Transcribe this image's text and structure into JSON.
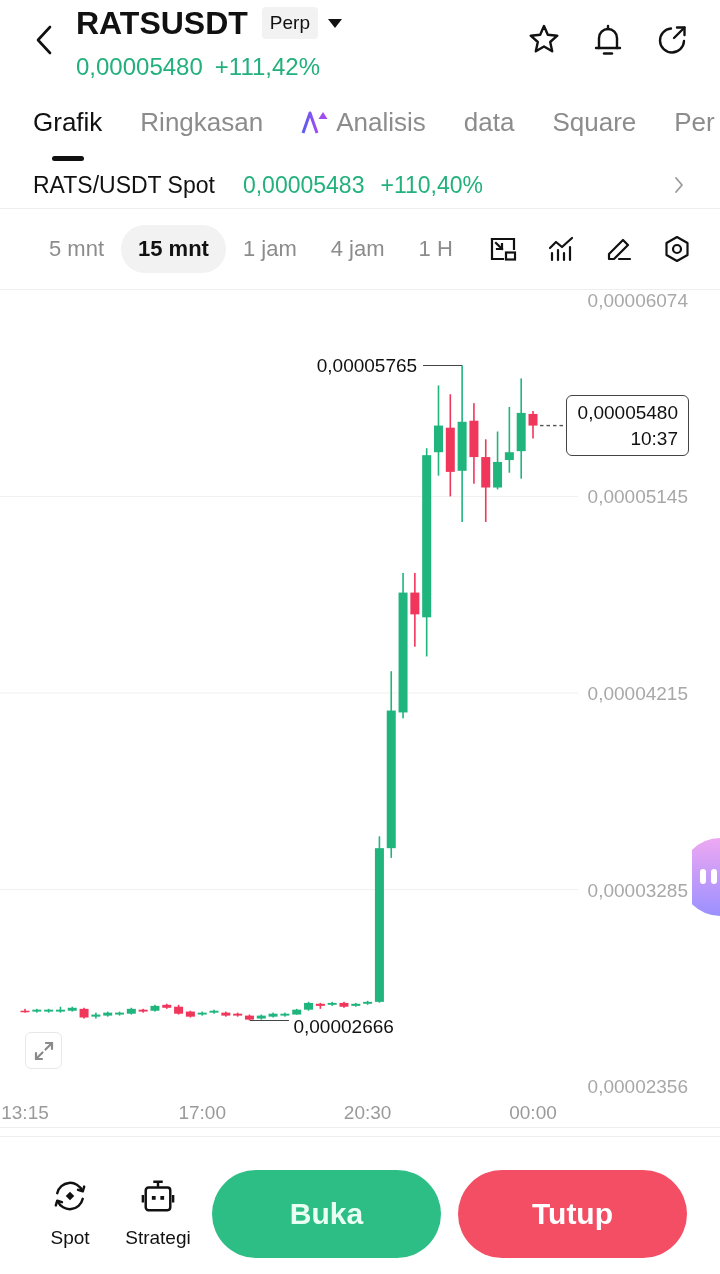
{
  "header": {
    "title": "RATSUSDT",
    "badge": "Perp",
    "price": "0,00005480",
    "change": "+111,42%"
  },
  "tabs": [
    {
      "label": "Grafik",
      "kind": "plain",
      "selected": true
    },
    {
      "label": "Ringkasan",
      "kind": "plain",
      "selected": false
    },
    {
      "label": "Analisis",
      "kind": "ai",
      "selected": false
    },
    {
      "label": "data",
      "kind": "plain",
      "selected": false
    },
    {
      "label": "Square",
      "kind": "plain",
      "selected": false
    },
    {
      "label": "Per",
      "kind": "plain",
      "selected": false
    }
  ],
  "spot_ticker": {
    "pair": "RATS/USDT Spot",
    "price": "0,00005483",
    "change": "+110,40%"
  },
  "timeframes": [
    {
      "label": "5 mnt",
      "selected": false
    },
    {
      "label": "15 mnt",
      "selected": true
    },
    {
      "label": "1 jam",
      "selected": false
    },
    {
      "label": "4 jam",
      "selected": false
    },
    {
      "label": "1 H",
      "selected": false
    }
  ],
  "chart": {
    "chart_data": {
      "type": "candlestick",
      "x": [
        13.25,
        13.5,
        13.75,
        14,
        14.25,
        14.5,
        14.75,
        15,
        15.25,
        15.5,
        15.75,
        16,
        16.25,
        16.5,
        16.75,
        17,
        17.25,
        17.5,
        17.75,
        18,
        18.25,
        18.5,
        18.75,
        19,
        19.25,
        19.5,
        19.75,
        20,
        20.25,
        20.5,
        20.75,
        21,
        21.25,
        21.5,
        21.75,
        22,
        22.25,
        22.5,
        22.75,
        23,
        23.25,
        23.5,
        23.75,
        24
      ],
      "ohlc": [
        [
          2.712e-05,
          2.721e-05,
          2.703e-05,
          2.708e-05
        ],
        [
          2.708e-05,
          2.721e-05,
          2.703e-05,
          2.717e-05
        ],
        [
          2.708e-05,
          2.721e-05,
          2.703e-05,
          2.717e-05
        ],
        [
          2.708e-05,
          2.731e-05,
          2.703e-05,
          2.717e-05
        ],
        [
          2.712e-05,
          2.731e-05,
          2.708e-05,
          2.726e-05
        ],
        [
          2.721e-05,
          2.726e-05,
          2.675e-05,
          2.68e-05
        ],
        [
          2.684e-05,
          2.703e-05,
          2.675e-05,
          2.694e-05
        ],
        [
          2.689e-05,
          2.708e-05,
          2.684e-05,
          2.703e-05
        ],
        [
          2.694e-05,
          2.708e-05,
          2.689e-05,
          2.703e-05
        ],
        [
          2.698e-05,
          2.726e-05,
          2.694e-05,
          2.721e-05
        ],
        [
          2.717e-05,
          2.721e-05,
          2.703e-05,
          2.708e-05
        ],
        [
          2.712e-05,
          2.74e-05,
          2.708e-05,
          2.735e-05
        ],
        [
          2.74e-05,
          2.745e-05,
          2.721e-05,
          2.726e-05
        ],
        [
          2.731e-05,
          2.74e-05,
          2.694e-05,
          2.698e-05
        ],
        [
          2.708e-05,
          2.712e-05,
          2.68e-05,
          2.684e-05
        ],
        [
          2.694e-05,
          2.708e-05,
          2.689e-05,
          2.703e-05
        ],
        [
          2.703e-05,
          2.717e-05,
          2.698e-05,
          2.712e-05
        ],
        [
          2.703e-05,
          2.708e-05,
          2.684e-05,
          2.689e-05
        ],
        [
          2.698e-05,
          2.703e-05,
          2.684e-05,
          2.689e-05
        ],
        [
          2.689e-05,
          2.694e-05,
          2.666e-05,
          2.67e-05
        ],
        [
          2.675e-05,
          2.694e-05,
          2.67e-05,
          2.689e-05
        ],
        [
          2.684e-05,
          2.703e-05,
          2.68e-05,
          2.698e-05
        ],
        [
          2.689e-05,
          2.703e-05,
          2.684e-05,
          2.698e-05
        ],
        [
          2.694e-05,
          2.721e-05,
          2.694e-05,
          2.717e-05
        ],
        [
          2.717e-05,
          2.754e-05,
          2.712e-05,
          2.749e-05
        ],
        [
          2.745e-05,
          2.749e-05,
          2.721e-05,
          2.735e-05
        ],
        [
          2.74e-05,
          2.754e-05,
          2.735e-05,
          2.749e-05
        ],
        [
          2.749e-05,
          2.754e-05,
          2.726e-05,
          2.731e-05
        ],
        [
          2.735e-05,
          2.749e-05,
          2.731e-05,
          2.745e-05
        ],
        [
          2.745e-05,
          2.759e-05,
          2.74e-05,
          2.754e-05
        ],
        [
          2.754e-05,
          3.537e-05,
          2.75e-05,
          3.481e-05
        ],
        [
          3.481e-05,
          4.318e-05,
          3.435e-05,
          4.132e-05
        ],
        [
          4.123e-05,
          4.783e-05,
          4.095e-05,
          4.69e-05
        ],
        [
          4.69e-05,
          4.783e-05,
          4.434e-05,
          4.587e-05
        ],
        [
          4.573e-05,
          5.373e-05,
          4.388e-05,
          5.34e-05
        ],
        [
          5.354e-05,
          5.67e-05,
          5.243e-05,
          5.48e-05
        ],
        [
          5.47e-05,
          5.628e-05,
          5.145e-05,
          5.261e-05
        ],
        [
          5.266e-05,
          5.765e-05,
          5.024e-05,
          5.498e-05
        ],
        [
          5.503e-05,
          5.586e-05,
          5.205e-05,
          5.331e-05
        ],
        [
          5.331e-05,
          5.415e-05,
          5.024e-05,
          5.187e-05
        ],
        [
          5.187e-05,
          5.452e-05,
          5.178e-05,
          5.308e-05
        ],
        [
          5.317e-05,
          5.568e-05,
          5.257e-05,
          5.354e-05
        ],
        [
          5.359e-05,
          5.703e-05,
          5.229e-05,
          5.54e-05
        ],
        [
          5.535e-05,
          5.549e-05,
          5.419e-05,
          5.48e-05
        ]
      ],
      "xlim": [
        13.25,
        24
      ],
      "ylim": [
        2.356e-05,
        6.074e-05
      ],
      "xticks": [
        {
          "value": 13.25,
          "label": "13:15"
        },
        {
          "value": 17,
          "label": "17:00"
        },
        {
          "value": 20.5,
          "label": "20:30"
        },
        {
          "value": 24,
          "label": "00:00"
        }
      ],
      "yticks": [
        {
          "value": 6.074e-05,
          "label": "0,00006074"
        },
        {
          "value": 5.145e-05,
          "label": "0,00005145"
        },
        {
          "value": 4.215e-05,
          "label": "0,00004215"
        },
        {
          "value": 3.285e-05,
          "label": "0,00003285"
        },
        {
          "value": 2.356e-05,
          "label": "0,00002356"
        }
      ],
      "grid": true
    },
    "high_label": "0,00005765",
    "low_label": "0,00002666",
    "last_price": "0,00005480",
    "countdown": "10:37"
  },
  "bottom_bar": {
    "shortcuts": [
      {
        "label": "Spot",
        "kind": "spot"
      },
      {
        "label": "Strategi",
        "kind": "robot"
      }
    ],
    "buttons": [
      {
        "label": "Buka",
        "kind": "open"
      },
      {
        "label": "Tutup",
        "kind": "close"
      }
    ]
  }
}
